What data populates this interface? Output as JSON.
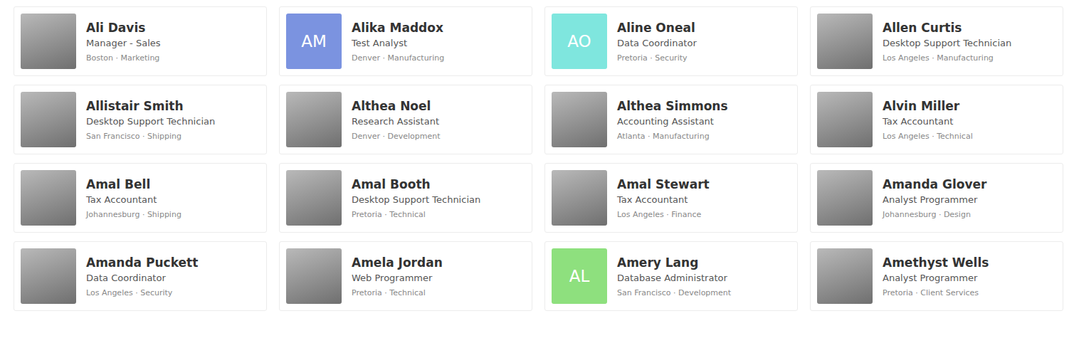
{
  "people": [
    {
      "name": "Ali Davis",
      "title": "Manager - Sales",
      "location": "Boston · Marketing",
      "kind": "photo"
    },
    {
      "name": "Alika Maddox",
      "title": "Test Analyst",
      "location": "Denver · Manufacturing",
      "kind": "initials",
      "initials": "AM",
      "color": "#7b93e0"
    },
    {
      "name": "Aline Oneal",
      "title": "Data Coordinator",
      "location": "Pretoria · Security",
      "kind": "initials",
      "initials": "AO",
      "color": "#7fe6de"
    },
    {
      "name": "Allen Curtis",
      "title": "Desktop Support Technician",
      "location": "Los Angeles · Manufacturing",
      "kind": "photo"
    },
    {
      "name": "Allistair Smith",
      "title": "Desktop Support Technician",
      "location": "San Francisco · Shipping",
      "kind": "photo"
    },
    {
      "name": "Althea Noel",
      "title": "Research Assistant",
      "location": "Denver · Development",
      "kind": "photo"
    },
    {
      "name": "Althea Simmons",
      "title": "Accounting Assistant",
      "location": "Atlanta · Manufacturing",
      "kind": "photo"
    },
    {
      "name": "Alvin Miller",
      "title": "Tax Accountant",
      "location": "Los Angeles · Technical",
      "kind": "photo"
    },
    {
      "name": "Amal Bell",
      "title": "Tax Accountant",
      "location": "Johannesburg · Shipping",
      "kind": "photo"
    },
    {
      "name": "Amal Booth",
      "title": "Desktop Support Technician",
      "location": "Pretoria · Technical",
      "kind": "photo"
    },
    {
      "name": "Amal Stewart",
      "title": "Tax Accountant",
      "location": "Los Angeles · Finance",
      "kind": "photo"
    },
    {
      "name": "Amanda Glover",
      "title": "Analyst Programmer",
      "location": "Johannesburg · Design",
      "kind": "photo"
    },
    {
      "name": "Amanda Puckett",
      "title": "Data Coordinator",
      "location": "Los Angeles · Security",
      "kind": "photo"
    },
    {
      "name": "Amela Jordan",
      "title": "Web Programmer",
      "location": "Pretoria · Technical",
      "kind": "photo"
    },
    {
      "name": "Amery Lang",
      "title": "Database Administrator",
      "location": "San Francisco · Development",
      "kind": "initials",
      "initials": "AL",
      "color": "#8ee07e"
    },
    {
      "name": "Amethyst Wells",
      "title": "Analyst Programmer",
      "location": "Pretoria · Client Services",
      "kind": "photo"
    }
  ]
}
